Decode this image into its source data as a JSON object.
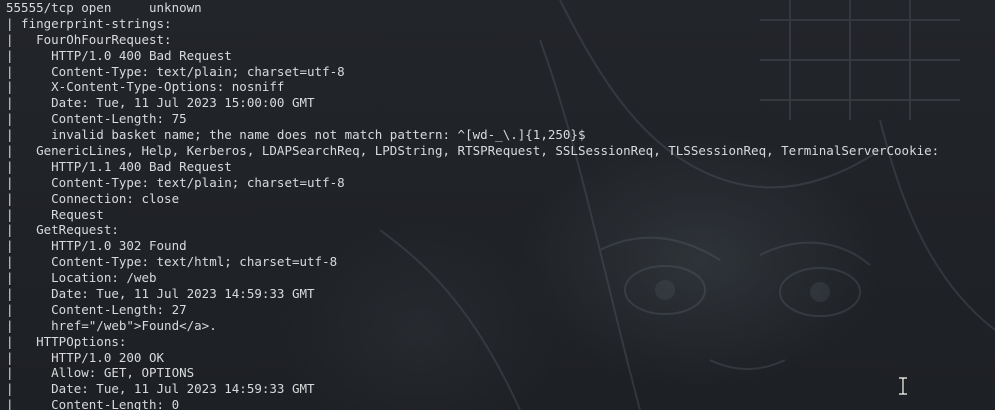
{
  "terminal": {
    "lines": [
      "55555/tcp open     unknown",
      "| fingerprint-strings:",
      "|   FourOhFourRequest:",
      "|     HTTP/1.0 400 Bad Request",
      "|     Content-Type: text/plain; charset=utf-8",
      "|     X-Content-Type-Options: nosniff",
      "|     Date: Tue, 11 Jul 2023 15:00:00 GMT",
      "|     Content-Length: 75",
      "|     invalid basket name; the name does not match pattern: ^[wd-_\\.]{1,250}$",
      "|   GenericLines, Help, Kerberos, LDAPSearchReq, LPDString, RTSPRequest, SSLSessionReq, TLSSessionReq, TerminalServerCookie:",
      "|     HTTP/1.1 400 Bad Request",
      "|     Content-Type: text/plain; charset=utf-8",
      "|     Connection: close",
      "|     Request",
      "|   GetRequest:",
      "|     HTTP/1.0 302 Found",
      "|     Content-Type: text/html; charset=utf-8",
      "|     Location: /web",
      "|     Date: Tue, 11 Jul 2023 14:59:33 GMT",
      "|     Content-Length: 27",
      "|     href=\"/web\">Found</a>.",
      "|   HTTPOptions:",
      "|     HTTP/1.0 200 OK",
      "|     Allow: GET, OPTIONS",
      "|     Date: Tue, 11 Jul 2023 14:59:33 GMT",
      "|     Content-Length: 0"
    ]
  },
  "colors": {
    "text": "#d8dadc",
    "background": "#1e2124"
  },
  "icons": {
    "cursor": "ibeam-cursor-icon"
  }
}
